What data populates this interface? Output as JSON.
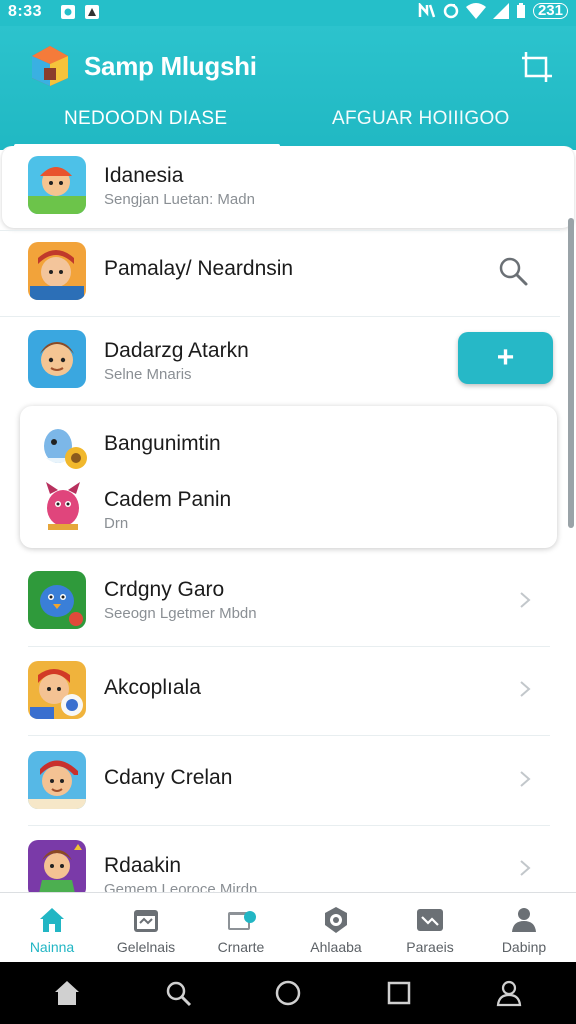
{
  "status_bar": {
    "time": "8:33",
    "right_icons": [
      "nfc-icon",
      "sync-icon",
      "wifi-icon",
      "signal-icon",
      "battery-icon"
    ],
    "battery_label": "231"
  },
  "app_bar": {
    "title": "Samp Mlugshi",
    "tabs": [
      {
        "label": "NEDOODN DIASE",
        "active": true
      },
      {
        "label": "AFGUAR HOIIIGOO",
        "active": false
      }
    ]
  },
  "list": {
    "items": [
      {
        "title": "Idanesia",
        "subtitle": "Sengjan Luetan: Madn"
      },
      {
        "title": "Pamalay/ Neardnsin",
        "subtitle": ""
      },
      {
        "title": "Dadarzg Atarkn",
        "subtitle": "Selne Mnaris"
      },
      {
        "title": "Bangunimtin",
        "subtitle": ""
      },
      {
        "title": "Cadem Panin",
        "subtitle": "Drn"
      },
      {
        "title": "Crdgny Garo",
        "subtitle": "Seeogn Lgetmer Mbdn"
      },
      {
        "title": "Akcoplıala",
        "subtitle": ""
      },
      {
        "title": "Cdany Crelan",
        "subtitle": ""
      },
      {
        "title": "Rdaakin",
        "subtitle": "Gemem Leoroce Mirdn"
      }
    ],
    "add_button_label": "+"
  },
  "bottom_nav": [
    {
      "label": "Nainna",
      "icon": "home-icon",
      "active": true
    },
    {
      "label": "Gelelnais",
      "icon": "calendar-icon",
      "active": false
    },
    {
      "label": "Crnarte",
      "icon": "folder-icon",
      "active": false
    },
    {
      "label": "Ahlaaba",
      "icon": "badge-icon",
      "active": false
    },
    {
      "label": "Paraeis",
      "icon": "media-icon",
      "active": false
    },
    {
      "label": "Dabinp",
      "icon": "profile-icon",
      "active": false
    }
  ],
  "colors": {
    "accent": "#25bfc9",
    "button": "#26b8c7",
    "active_nav": "#22b6c4"
  }
}
